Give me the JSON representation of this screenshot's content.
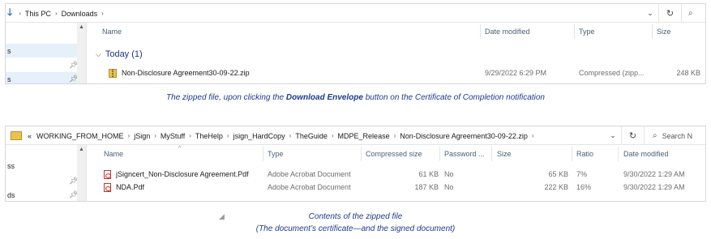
{
  "window1": {
    "breadcrumb": [
      "This PC",
      "Downloads"
    ],
    "nav": {
      "items": [
        "s",
        "",
        "s"
      ]
    },
    "columns": {
      "name": "Name",
      "date": "Date modified",
      "type": "Type",
      "size": "Size"
    },
    "group": "Today (1)",
    "rows": [
      {
        "name": "Non-Disclosure Agreement30-09-22.zip",
        "date": "9/29/2022 6:29 PM",
        "type": "Compressed (zipp...",
        "size": "248 KB"
      }
    ]
  },
  "caption1": {
    "before": "The zipped file, upon clicking the ",
    "bold": "Download Envelope",
    "after": " button on the Certificate of Completion notification"
  },
  "window2": {
    "breadcrumb": [
      "WORKING_FROM_HOME",
      "jSign",
      "MyStuff",
      "TheHelp",
      "jsign_HardCopy",
      "TheGuide",
      "MDPE_Release",
      "Non-Disclosure Agreement30-09-22.zip"
    ],
    "overflow": "«",
    "search_placeholder": "Search N",
    "nav": {
      "items": [
        "ss",
        "",
        "ds"
      ]
    },
    "columns": {
      "name": "Name",
      "type": "Type",
      "compressed": "Compressed size",
      "password": "Password ...",
      "size": "Size",
      "ratio": "Ratio",
      "date": "Date modified"
    },
    "rows": [
      {
        "name": "jSigncert_Non-Disclosure Agreement.Pdf",
        "type": "Adobe Acrobat Document",
        "compressed": "61 KB",
        "password": "No",
        "size": "65 KB",
        "ratio": "7%",
        "date": "9/30/2022 1:29 AM"
      },
      {
        "name": "NDA.Pdf",
        "type": "Adobe Acrobat Document",
        "compressed": "187 KB",
        "password": "No",
        "size": "222 KB",
        "ratio": "16%",
        "date": "9/30/2022 1:29 AM"
      }
    ]
  },
  "caption2": {
    "line1": "Contents of the zipped file",
    "line2": "(The document’s certificate—and the signed document)"
  },
  "icons": {
    "back": "down-arrow-icon",
    "pc": "pc-icon",
    "folder": "folder-icon",
    "zip": "zip-file-icon",
    "pdf": "pdf-file-icon",
    "pin": "pin-icon",
    "refresh": "refresh-icon",
    "search": "search-icon",
    "dropdown": "chevron-down-icon"
  },
  "colors": {
    "group_text": "#1e3287",
    "header_text": "#4c607a",
    "caption": "#1f3a8a",
    "nav_highlight": "#e5f0fb"
  }
}
